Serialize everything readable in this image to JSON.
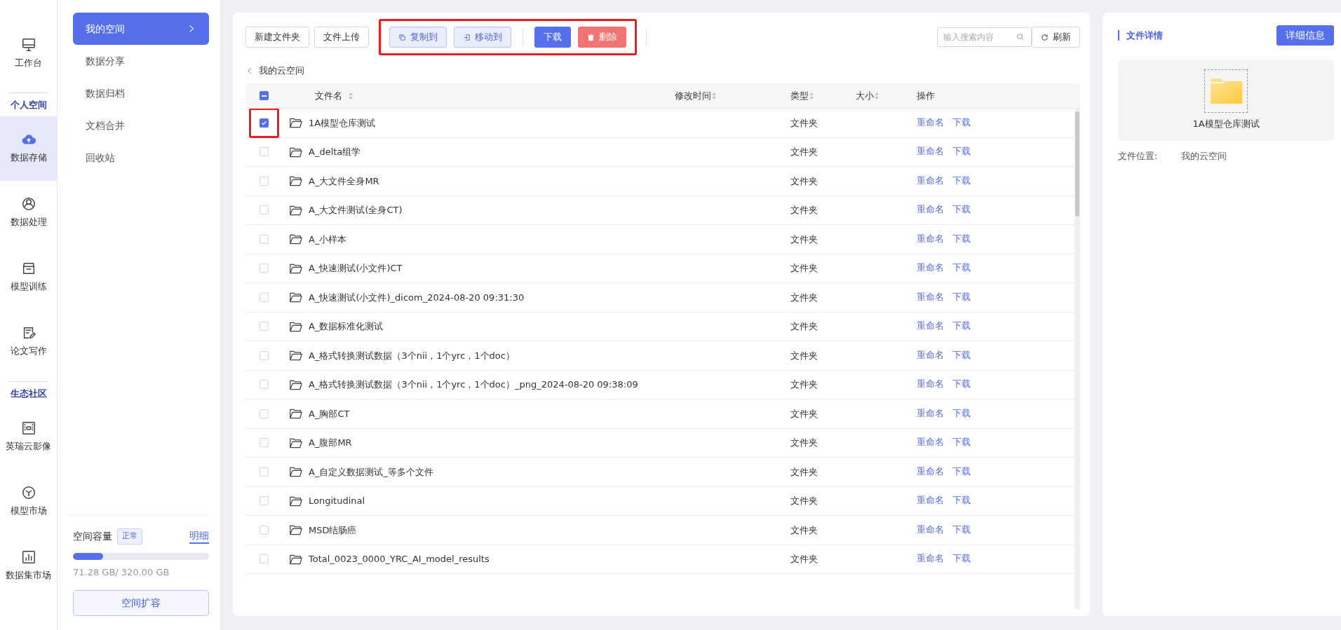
{
  "rail": {
    "items": [
      {
        "kind": "item",
        "label": "工作台",
        "selected": false
      },
      {
        "kind": "heading",
        "label": "个人空间"
      },
      {
        "kind": "item",
        "label": "数据存储",
        "selected": true
      },
      {
        "kind": "item",
        "label": "数据处理",
        "selected": false
      },
      {
        "kind": "item",
        "label": "模型训练",
        "selected": false
      },
      {
        "kind": "item",
        "label": "论文写作",
        "selected": false
      },
      {
        "kind": "heading",
        "label": "生态社区"
      },
      {
        "kind": "item",
        "label": "英瑞云影像",
        "selected": false
      },
      {
        "kind": "item",
        "label": "模型市场",
        "selected": false
      },
      {
        "kind": "item",
        "label": "数据集市场",
        "selected": false
      }
    ]
  },
  "submenu": {
    "items": [
      {
        "label": "我的空间",
        "selected": true
      },
      {
        "label": "数据分享",
        "selected": false
      },
      {
        "label": "数据归档",
        "selected": false
      },
      {
        "label": "文档合并",
        "selected": false
      },
      {
        "label": "回收站",
        "selected": false
      }
    ],
    "storage": {
      "label": "空间容量",
      "status": "正常",
      "detail_link": "明细",
      "level": 0.22,
      "usage": "71.28 GB/ 320.00 GB",
      "expand_button": "空间扩容"
    }
  },
  "toolbar": {
    "buttons": [
      {
        "kind": "plain",
        "label": "新建文件夹"
      },
      {
        "kind": "plain",
        "label": "文件上传"
      }
    ],
    "action_group": {
      "highlighted": true,
      "buttons": [
        {
          "kind": "light",
          "label": "复制到"
        },
        {
          "kind": "light",
          "label": "移动到"
        },
        {
          "kind": "primary",
          "label": "下载"
        },
        {
          "kind": "danger",
          "label": "删除"
        }
      ]
    },
    "search": {
      "placeholder": "输入搜索内容"
    },
    "refresh": "刷新"
  },
  "breadcrumb": "我的云空间",
  "table": {
    "header_checkbox_indeterminate": true,
    "columns": [
      {
        "label": "文件名",
        "sortable": true
      },
      {
        "label": "修改时间",
        "sortable": true
      },
      {
        "label": "类型",
        "sortable": true
      },
      {
        "label": "大小",
        "sortable": true
      },
      {
        "label": "操作",
        "sortable": false
      }
    ],
    "rows": [
      {
        "name": "1A模型仓库测试",
        "type": "文件夹",
        "actions": [
          "重命名",
          "下载"
        ],
        "selected": true,
        "highlighted": true
      },
      {
        "name": "A_delta组学",
        "type": "文件夹",
        "actions": [
          "重命名",
          "下载"
        ],
        "selected": false,
        "highlighted": false
      },
      {
        "name": "A_大文件全身MR",
        "type": "文件夹",
        "actions": [
          "重命名",
          "下载"
        ],
        "selected": false,
        "highlighted": false
      },
      {
        "name": "A_大文件测试(全身CT)",
        "type": "文件夹",
        "actions": [
          "重命名",
          "下载"
        ],
        "selected": false,
        "highlighted": false
      },
      {
        "name": "A_小样本",
        "type": "文件夹",
        "actions": [
          "重命名",
          "下载"
        ],
        "selected": false,
        "highlighted": false
      },
      {
        "name": "A_快速测试(小文件)CT",
        "type": "文件夹",
        "actions": [
          "重命名",
          "下载"
        ],
        "selected": false,
        "highlighted": false
      },
      {
        "name": "A_快速测试(小文件)_dicom_2024-08-20 09:31:30",
        "type": "文件夹",
        "actions": [
          "重命名",
          "下载"
        ],
        "selected": false,
        "highlighted": false
      },
      {
        "name": "A_数据标准化测试",
        "type": "文件夹",
        "actions": [
          "重命名",
          "下载"
        ],
        "selected": false,
        "highlighted": false
      },
      {
        "name": "A_格式转换测试数据（3个nii，1个yrc，1个doc）",
        "type": "文件夹",
        "actions": [
          "重命名",
          "下载"
        ],
        "selected": false,
        "highlighted": false
      },
      {
        "name": "A_格式转换测试数据（3个nii，1个yrc，1个doc）_png_2024-08-20 09:38:09",
        "type": "文件夹",
        "actions": [
          "重命名",
          "下载"
        ],
        "selected": false,
        "highlighted": false
      },
      {
        "name": "A_胸部CT",
        "type": "文件夹",
        "actions": [
          "重命名",
          "下载"
        ],
        "selected": false,
        "highlighted": false
      },
      {
        "name": "A_腹部MR",
        "type": "文件夹",
        "actions": [
          "重命名",
          "下载"
        ],
        "selected": false,
        "highlighted": false
      },
      {
        "name": "A_自定义数据测试_等多个文件",
        "type": "文件夹",
        "actions": [
          "重命名",
          "下载"
        ],
        "selected": false,
        "highlighted": false
      },
      {
        "name": "Longitudinal",
        "type": "文件夹",
        "actions": [
          "重命名",
          "下载"
        ],
        "selected": false,
        "highlighted": false
      },
      {
        "name": "MSD结肠癌",
        "type": "文件夹",
        "actions": [
          "重命名",
          "下载"
        ],
        "selected": false,
        "highlighted": false
      },
      {
        "name": "Total_0023_0000_YRC_AI_model_results",
        "type": "文件夹",
        "actions": [
          "重命名",
          "下载"
        ],
        "selected": false,
        "highlighted": false
      }
    ]
  },
  "details": {
    "title": "文件详情",
    "button": "详细信息",
    "preview_name": "1A模型仓库测试",
    "location_label": "文件位置:",
    "location_value": "我的云空间"
  }
}
